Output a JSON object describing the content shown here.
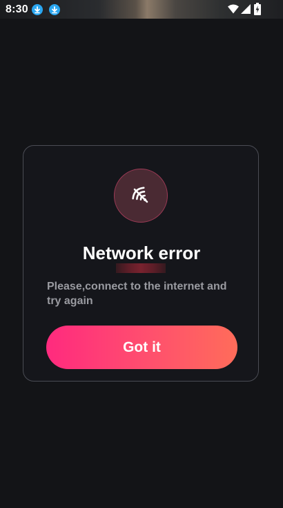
{
  "status_bar": {
    "time": "8:30",
    "icons": [
      "download-icon",
      "download-icon",
      "wifi-icon",
      "cellular-signal-icon",
      "battery-charging-icon"
    ]
  },
  "dialog": {
    "icon": "wifi-off-icon",
    "title": "Network error",
    "message": "Please,connect to the internet and try again",
    "button_label": "Got it"
  },
  "colors": {
    "background": "#131417",
    "dialog_background": "#15161b",
    "dialog_border": "#4b4d55",
    "badge_background": "#4a2a33",
    "badge_border": "#9e3a56",
    "message_text": "#9a9ba1",
    "button_gradient_start": "#ff2a7e",
    "button_gradient_end": "#ff6c5a",
    "download_icon": "#2aa6f0"
  }
}
